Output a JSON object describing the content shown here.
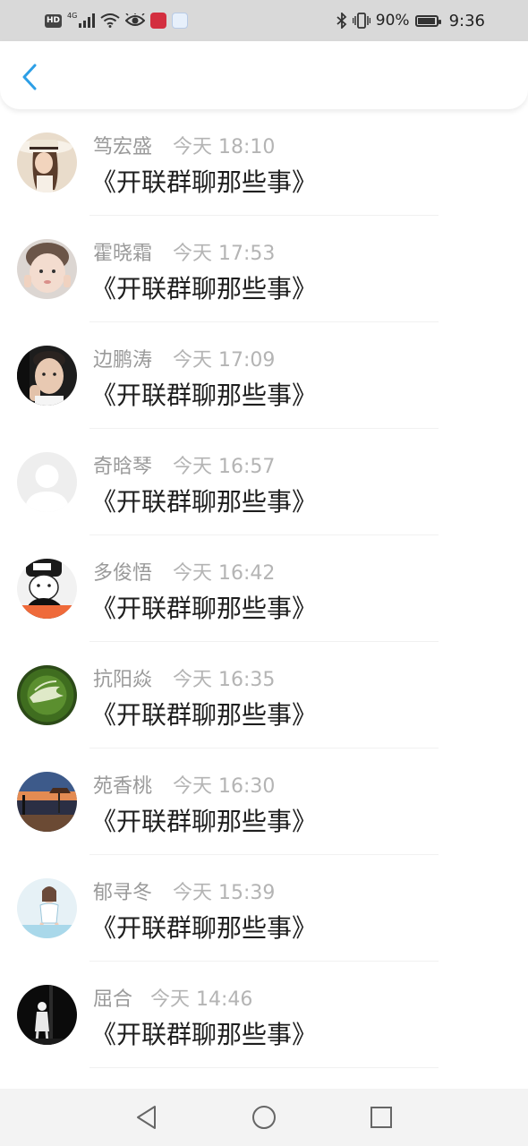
{
  "status_bar": {
    "network_badge": "HD",
    "network_type": "4G",
    "battery_percent": "90%",
    "time": "9:36",
    "icons": [
      "hd-icon",
      "signal-icon",
      "wifi-icon",
      "eye-icon",
      "app-red-icon",
      "app-baidu-icon",
      "bluetooth-icon",
      "vibrate-icon",
      "battery-icon"
    ]
  },
  "header": {
    "back_icon": "chevron-left-icon",
    "accent_color": "#2d9fe6"
  },
  "messages": [
    {
      "name": "笃宏盛",
      "time": "今天 18:10",
      "text": "《开联群聊那些事》",
      "avatar": "avatar-woman-hat"
    },
    {
      "name": "霍晓霜",
      "time": "今天 17:53",
      "text": "《开联群聊那些事》",
      "avatar": "avatar-child"
    },
    {
      "name": "边鹏涛",
      "time": "今天 17:09",
      "text": "《开联群聊那些事》",
      "avatar": "avatar-young-man"
    },
    {
      "name": "奇晗琴",
      "time": "今天 16:57",
      "text": "《开联群聊那些事》",
      "avatar": "avatar-default"
    },
    {
      "name": "多俊悟",
      "time": "今天 16:42",
      "text": "《开联群聊那些事》",
      "avatar": "avatar-cartoon-boy"
    },
    {
      "name": "抗阳焱",
      "time": "今天 16:35",
      "text": "《开联群聊那些事》",
      "avatar": "avatar-latte-art"
    },
    {
      "name": "苑香桃",
      "time": "今天 16:30",
      "text": "《开联群聊那些事》",
      "avatar": "avatar-sunset-beach"
    },
    {
      "name": "郁寻冬",
      "time": "今天 15:39",
      "text": "《开联群聊那些事》",
      "avatar": "avatar-girl-drawing"
    },
    {
      "name": "屈合",
      "time": "今天 14:46",
      "text": "《开联群聊那些事》",
      "avatar": "avatar-night-figure"
    }
  ],
  "nav_bar": {
    "back_icon": "triangle-back-icon",
    "home_icon": "circle-home-icon",
    "recents_icon": "square-recents-icon"
  }
}
